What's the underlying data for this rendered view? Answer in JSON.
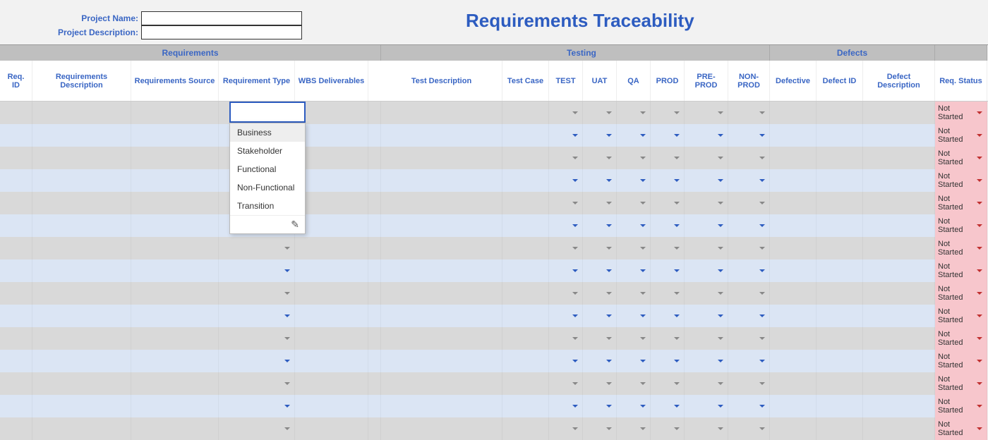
{
  "header": {
    "title": "Requirements Traceability",
    "project_name_label": "Project Name:",
    "project_description_label": "Project Description:",
    "project_name_value": "",
    "project_description_value": ""
  },
  "groups": {
    "requirements": "Requirements",
    "testing": "Testing",
    "defects": "Defects",
    "status": ""
  },
  "columns": {
    "req_id": "Req. ID",
    "req_desc": "Requirements Description",
    "req_src": "Requirements Source",
    "req_type": "Requirement Type",
    "wbs": "WBS Deliverables",
    "test_desc": "Test Description",
    "test_case": "Test Case",
    "test": "TEST",
    "uat": "UAT",
    "qa": "QA",
    "prod": "PROD",
    "preprod": "PRE-PROD",
    "nonprod": "NON-PROD",
    "defective": "Defective",
    "defect_id": "Defect ID",
    "defect_desc": "Defect Description",
    "req_status": "Req. Status"
  },
  "req_type_dropdown": {
    "options": [
      "Business",
      "Stakeholder",
      "Functional",
      "Non-Functional",
      "Transition"
    ],
    "hovered_index": 0
  },
  "status_default": "Not Started",
  "row_count": 15
}
